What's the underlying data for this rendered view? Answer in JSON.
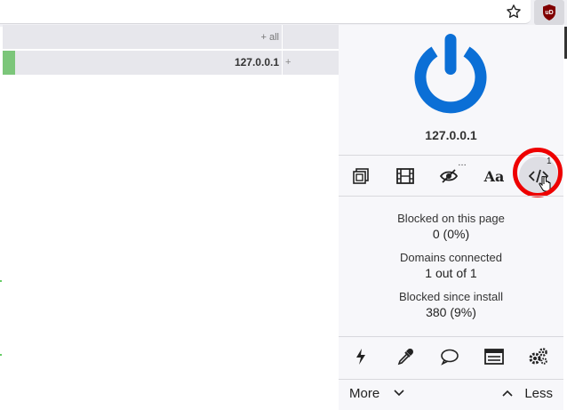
{
  "toolbar": {
    "bookmark_icon": "star-icon",
    "extension_icon": "ublock-origin-icon",
    "extension_badge": "uD"
  },
  "firewall": {
    "rows": [
      {
        "host": "",
        "rule": "+ all"
      },
      {
        "host": "127.0.0.1",
        "rule": "+"
      }
    ]
  },
  "panel": {
    "hostname": "127.0.0.1",
    "power_icon": "power-icon",
    "accent": "#0b6fd6",
    "tools": [
      {
        "icon": "popup-block-icon"
      },
      {
        "icon": "media-block-icon"
      },
      {
        "icon": "cosmetic-filter-icon",
        "badge": "…"
      },
      {
        "icon": "remote-fonts-icon",
        "label": "Aa"
      },
      {
        "icon": "script-toggle-icon",
        "badge": "1"
      }
    ],
    "stats": [
      {
        "label": "Blocked on this page",
        "value": "0 (0%)"
      },
      {
        "label": "Domains connected",
        "value": "1 out of 1"
      },
      {
        "label": "Blocked since install",
        "value": "380 (9%)"
      }
    ],
    "bottom_tools": [
      {
        "icon": "lightning-icon"
      },
      {
        "icon": "eyedropper-icon"
      },
      {
        "icon": "speech-bubble-icon"
      },
      {
        "icon": "logger-icon"
      },
      {
        "icon": "settings-gears-icon"
      }
    ],
    "more_label": "More",
    "less_label": "Less"
  }
}
